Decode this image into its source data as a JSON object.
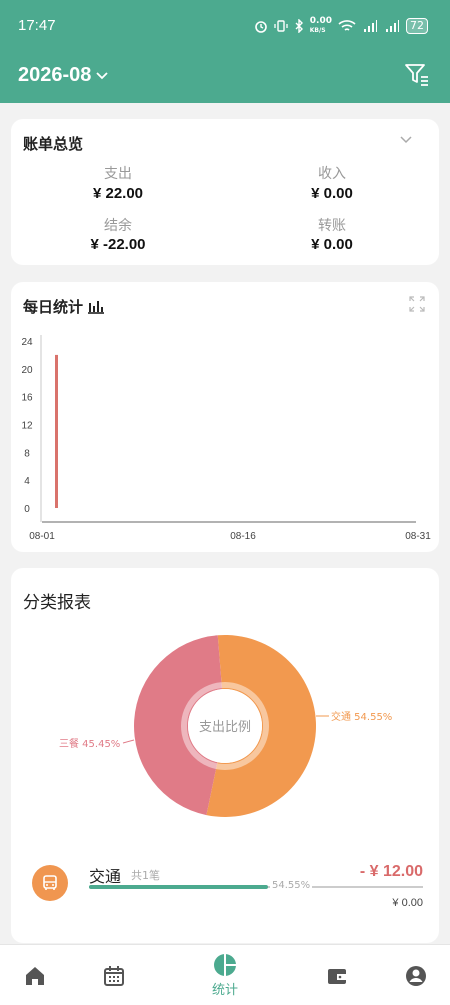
{
  "status": {
    "time": "17:47",
    "net_speed_top": "0.00",
    "net_speed_unit": "KB/S",
    "battery": "72"
  },
  "header": {
    "month": "2026-08"
  },
  "overview": {
    "title": "账单总览",
    "items": [
      {
        "label": "支出",
        "value": "¥ 22.00"
      },
      {
        "label": "收入",
        "value": "¥ 0.00"
      },
      {
        "label": "结余",
        "value": "¥ -22.00"
      },
      {
        "label": "转账",
        "value": "¥ 0.00"
      }
    ]
  },
  "daily": {
    "title": "每日统计"
  },
  "chart_data": [
    {
      "type": "bar",
      "title": "每日统计",
      "xlabel": "",
      "ylabel": "",
      "ylim": [
        0,
        24
      ],
      "yticks": [
        "24",
        "20",
        "16",
        "12",
        "8",
        "4",
        "0"
      ],
      "xticks": [
        "08-01",
        "08-16",
        "08-31"
      ],
      "x": [
        "08-01"
      ],
      "values": [
        22
      ],
      "color": "#d9736c",
      "grid": false
    },
    {
      "type": "pie",
      "title": "支出比例",
      "slices": [
        {
          "name": "交通",
          "value": 54.55,
          "label": "交通 54.55%",
          "color": "#f2994f"
        },
        {
          "name": "三餐",
          "value": 45.45,
          "label": "三餐 45.45%",
          "color": "#e07b87"
        }
      ]
    }
  ],
  "category": {
    "title": "分类报表",
    "donut_center": "支出比例",
    "list": [
      {
        "name": "交通",
        "count": "共1笔",
        "amount": "- ¥ 12.00",
        "percent_label": "54.55%",
        "percent": 54.55,
        "sub_amount": "¥ 0.00",
        "icon": "bus-icon"
      }
    ]
  },
  "nav": {
    "items": [
      {
        "icon": "home-icon"
      },
      {
        "icon": "calendar-icon"
      },
      {
        "icon": "stats-icon",
        "label": "统计",
        "active": true
      },
      {
        "icon": "wallet-icon"
      },
      {
        "icon": "user-icon"
      }
    ]
  },
  "colors": {
    "primary": "#4caa8f",
    "expense": "#d96a6a"
  }
}
